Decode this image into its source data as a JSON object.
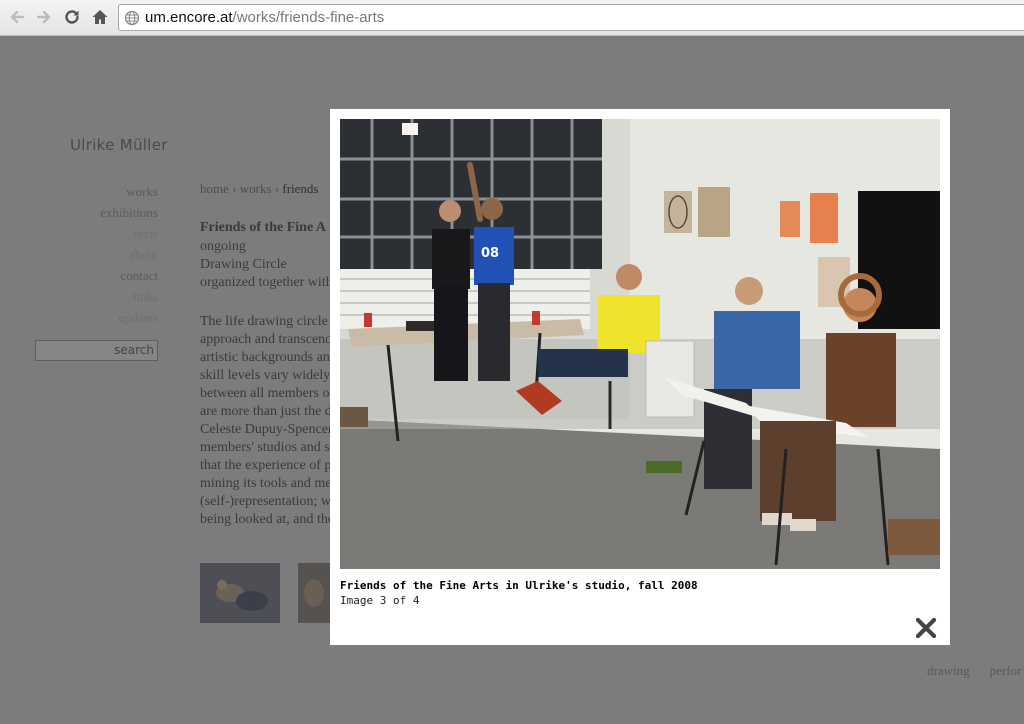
{
  "browser": {
    "url_host": "um.encore.at",
    "url_path": "/works/friends-fine-arts"
  },
  "site": {
    "title": "Ulrike Müller",
    "nav": [
      "works",
      "exhibitions",
      "texts",
      "about",
      "contact",
      "links",
      "updates"
    ],
    "search_label": "search"
  },
  "breadcrumb": {
    "home": "home",
    "sep": "›",
    "works": "works",
    "current": "friends"
  },
  "work": {
    "title": "Friends of the Fine A",
    "status": "ongoing",
    "type": "Drawing Circle",
    "organized": "organized together with"
  },
  "body_lines": [
    "The life drawing circle                                                                                                                           a traditional",
    "approach and transcend                                                                                                                          wide variety",
    "artistic backgrounds an                                                                                                                           endering the",
    "skill levels vary widely,                                                                                                                           nsmitted equ",
    "between all members o                                                                                                                           erience, the p",
    "are more than just the d",
    "Celeste Dupuy-Spencer                                                                                                                          has been mee",
    "members' studios and s                                                                                                                          t became app",
    "that the experience of p                                                                                                                          c tradition, b",
    "mining its tools and me                                                                                                                          for performa",
    "(self-)representation; w                                                                                                                          es, the sexual",
    "being looked at, and the"
  ],
  "tags": [
    "drawing",
    "perfor"
  ],
  "lightbox": {
    "caption": "Friends of the Fine Arts in Ulrike's studio, fall 2008",
    "counter": "Image 3 of 4"
  },
  "icons": {
    "back": "back-arrow-icon",
    "forward": "forward-arrow-icon",
    "reload": "reload-icon",
    "home": "home-icon",
    "globe": "globe-icon",
    "close": "close-icon"
  }
}
